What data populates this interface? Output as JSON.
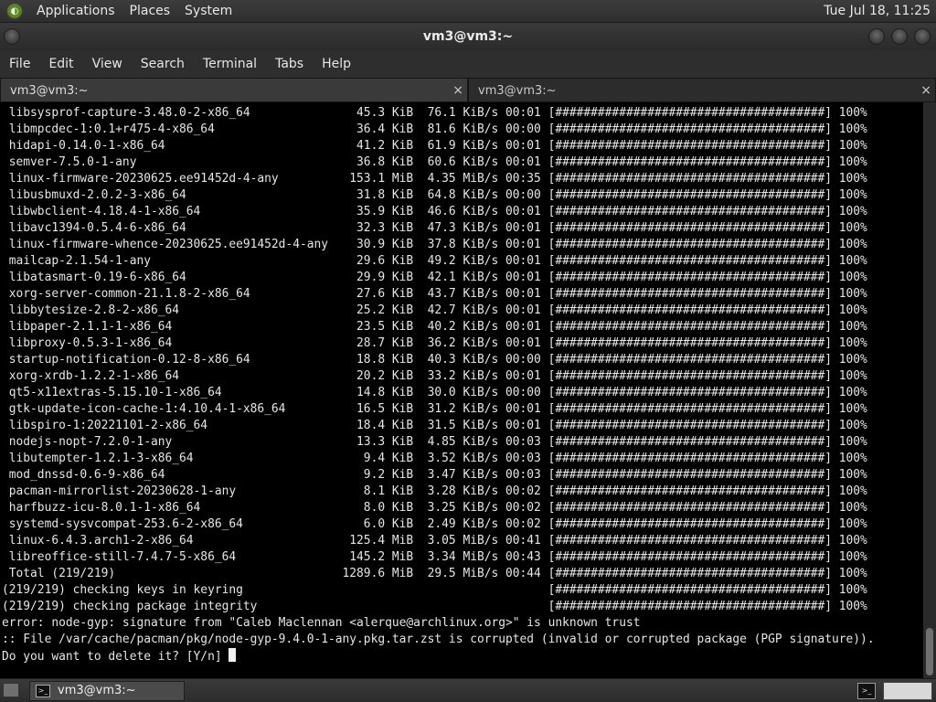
{
  "top_panel": {
    "menus": [
      "Applications",
      "Places",
      "System"
    ],
    "clock": "Tue Jul 18, 11:25"
  },
  "window": {
    "title": "vm3@vm3:~"
  },
  "menubar": [
    "File",
    "Edit",
    "View",
    "Search",
    "Terminal",
    "Tabs",
    "Help"
  ],
  "tabs": [
    {
      "label": "vm3@vm3:~",
      "close": "×"
    },
    {
      "label": "vm3@vm3:~",
      "close": "×"
    }
  ],
  "terminal": {
    "lines": [
      " libsysprof-capture-3.48.0-2-x86_64               45.3 KiB  76.1 KiB/s 00:01 [######################################] 100%",
      " libmpcdec-1:0.1+r475-4-x86_64                    36.4 KiB  81.6 KiB/s 00:00 [######################################] 100%",
      " hidapi-0.14.0-1-x86_64                           41.2 KiB  61.9 KiB/s 00:01 [######################################] 100%",
      " semver-7.5.0-1-any                               36.8 KiB  60.6 KiB/s 00:01 [######################################] 100%",
      " linux-firmware-20230625.ee91452d-4-any          153.1 MiB  4.35 MiB/s 00:35 [######################################] 100%",
      " libusbmuxd-2.0.2-3-x86_64                        31.8 KiB  64.8 KiB/s 00:00 [######################################] 100%",
      " libwbclient-4.18.4-1-x86_64                      35.9 KiB  46.6 KiB/s 00:01 [######################################] 100%",
      " libavc1394-0.5.4-6-x86_64                        32.3 KiB  47.3 KiB/s 00:01 [######################################] 100%",
      " linux-firmware-whence-20230625.ee91452d-4-any    30.9 KiB  37.8 KiB/s 00:01 [######################################] 100%",
      " mailcap-2.1.54-1-any                             29.6 KiB  49.2 KiB/s 00:01 [######################################] 100%",
      " libatasmart-0.19-6-x86_64                        29.9 KiB  42.1 KiB/s 00:01 [######################################] 100%",
      " xorg-server-common-21.1.8-2-x86_64               27.6 KiB  43.7 KiB/s 00:01 [######################################] 100%",
      " libbytesize-2.8-2-x86_64                         25.2 KiB  42.7 KiB/s 00:01 [######################################] 100%",
      " libpaper-2.1.1-1-x86_64                          23.5 KiB  40.2 KiB/s 00:01 [######################################] 100%",
      " libproxy-0.5.3-1-x86_64                          28.7 KiB  36.2 KiB/s 00:01 [######################################] 100%",
      " startup-notification-0.12-8-x86_64               18.8 KiB  40.3 KiB/s 00:00 [######################################] 100%",
      " xorg-xrdb-1.2.2-1-x86_64                         20.2 KiB  33.2 KiB/s 00:01 [######################################] 100%",
      " qt5-x11extras-5.15.10-1-x86_64                   14.8 KiB  30.0 KiB/s 00:00 [######################################] 100%",
      " gtk-update-icon-cache-1:4.10.4-1-x86_64          16.5 KiB  31.2 KiB/s 00:01 [######################################] 100%",
      " libspiro-1:20221101-2-x86_64                     18.4 KiB  31.5 KiB/s 00:01 [######################################] 100%",
      " nodejs-nopt-7.2.0-1-any                          13.3 KiB  4.85 KiB/s 00:03 [######################################] 100%",
      " libutempter-1.2.1-3-x86_64                        9.4 KiB  3.52 KiB/s 00:03 [######################################] 100%",
      " mod_dnssd-0.6-9-x86_64                            9.2 KiB  3.47 KiB/s 00:03 [######################################] 100%",
      " pacman-mirrorlist-20230628-1-any                  8.1 KiB  3.28 KiB/s 00:02 [######################################] 100%",
      " harfbuzz-icu-8.0.1-1-x86_64                       8.0 KiB  3.25 KiB/s 00:02 [######################################] 100%",
      " systemd-sysvcompat-253.6-2-x86_64                 6.0 KiB  2.49 KiB/s 00:02 [######################################] 100%",
      " linux-6.4.3.arch1-2-x86_64                      125.4 MiB  3.05 MiB/s 00:41 [######################################] 100%",
      " libreoffice-still-7.4.7-5-x86_64                145.2 MiB  3.34 MiB/s 00:43 [######################################] 100%",
      " Total (219/219)                                1289.6 MiB  29.5 MiB/s 00:44 [######################################] 100%",
      "(219/219) checking keys in keyring                                           [######################################] 100%",
      "(219/219) checking package integrity                                         [######################################] 100%",
      "error: node-gyp: signature from \"Caleb Maclennan <alerque@archlinux.org>\" is unknown trust",
      ":: File /var/cache/pacman/pkg/node-gyp-9.4.0-1-any.pkg.tar.zst is corrupted (invalid or corrupted package (PGP signature)).",
      "Do you want to delete it? [Y/n] "
    ]
  },
  "taskbar": {
    "window_button": "vm3@vm3:~"
  }
}
